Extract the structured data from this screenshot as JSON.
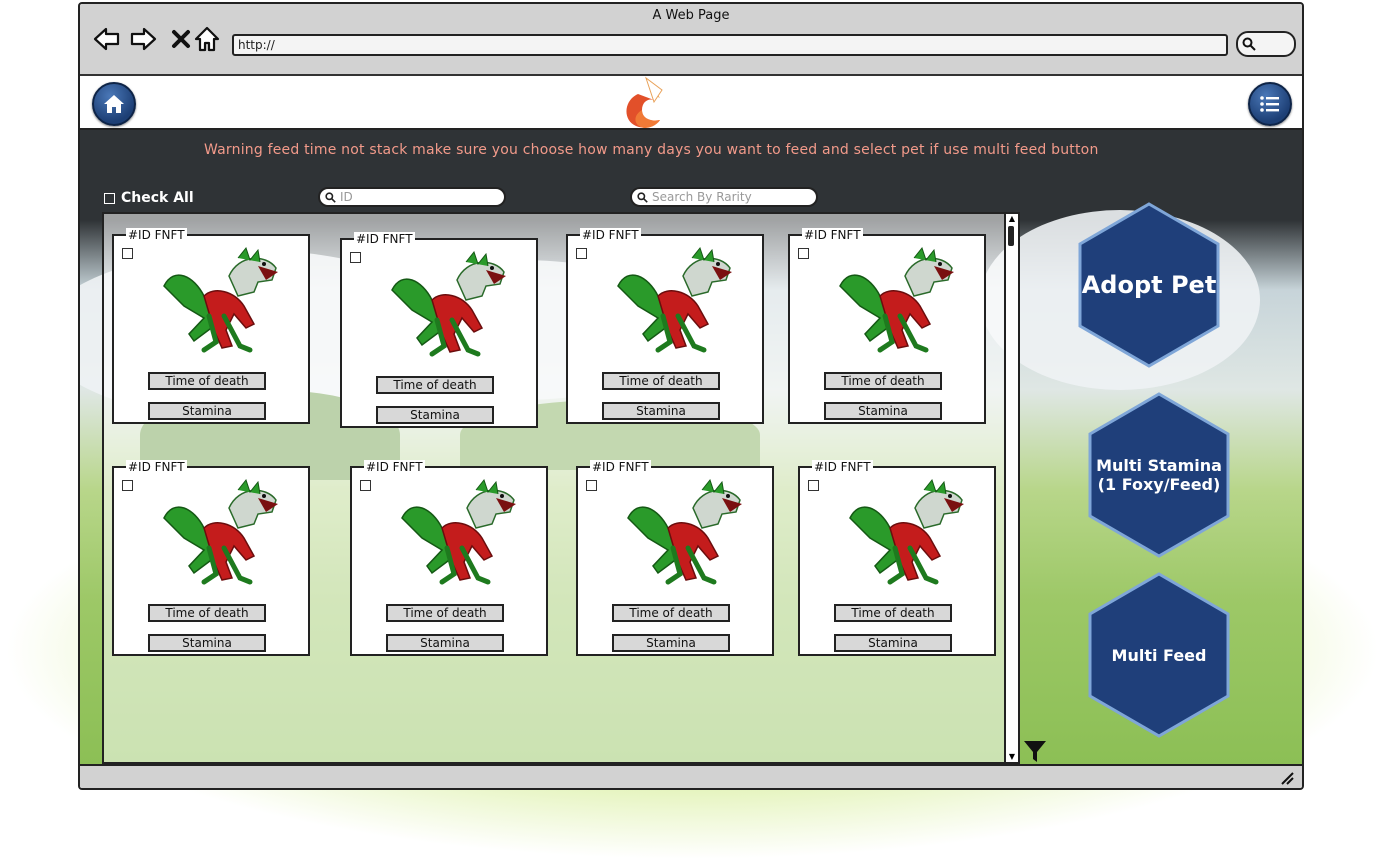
{
  "browser": {
    "title": "A Web Page",
    "url": "http://",
    "icons": [
      "back-icon",
      "forward-icon",
      "close-icon",
      "home-icon",
      "search-icon"
    ]
  },
  "header": {
    "home_icon": "home-icon",
    "menu_icon": "menu-icon",
    "logo_icon": "fox-logo"
  },
  "warning": "Warning feed time not stack make sure you choose how many days you want to feed and select pet if use multi feed button",
  "controls": {
    "check_all_label": "Check All",
    "id_search_placeholder": "ID",
    "rarity_search_placeholder": "Search By Rarity"
  },
  "pets": [
    {
      "id_label": "#ID FNFT",
      "time_label": "Time of death",
      "stamina_label": "Stamina"
    },
    {
      "id_label": "#ID FNFT",
      "time_label": "Time of death",
      "stamina_label": "Stamina"
    },
    {
      "id_label": "#ID FNFT",
      "time_label": "Time of death",
      "stamina_label": "Stamina"
    },
    {
      "id_label": "#ID FNFT",
      "time_label": "Time of death",
      "stamina_label": "Stamina"
    },
    {
      "id_label": "#ID FNFT",
      "time_label": "Time of death",
      "stamina_label": "Stamina"
    },
    {
      "id_label": "#ID FNFT",
      "time_label": "Time of death",
      "stamina_label": "Stamina"
    },
    {
      "id_label": "#ID FNFT",
      "time_label": "Time of death",
      "stamina_label": "Stamina"
    },
    {
      "id_label": "#ID FNFT",
      "time_label": "Time of death",
      "stamina_label": "Stamina"
    }
  ],
  "actions": {
    "adopt": "Adopt Pet",
    "multi_stamina_line1": "Multi Stamina",
    "multi_stamina_line2": "(1 Foxy/Feed)",
    "multi_feed": "Multi Feed"
  },
  "colors": {
    "warning_text": "#f29a8a",
    "hex_button": "#1f3f7a",
    "dark_sky": "#2f3336"
  }
}
